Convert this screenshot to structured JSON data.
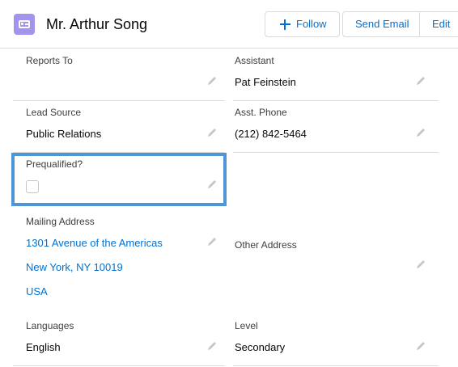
{
  "header": {
    "icon": "contact-card-icon",
    "title": "Mr. Arthur Song",
    "accent": "#a094ed"
  },
  "actions": {
    "follow": "Follow",
    "send_email": "Send Email",
    "edit": "Edit"
  },
  "fields": {
    "reports_to": {
      "label": "Reports To",
      "value": ""
    },
    "assistant": {
      "label": "Assistant",
      "value": "Pat Feinstein"
    },
    "lead_source": {
      "label": "Lead Source",
      "value": "Public Relations"
    },
    "asst_phone": {
      "label": "Asst. Phone",
      "value": "(212) 842-5464"
    },
    "prequalified": {
      "label": "Prequalified?",
      "checked": false
    },
    "mailing_address": {
      "label": "Mailing Address",
      "line1": "1301 Avenue of the Americas",
      "line2": "New York, NY 10019",
      "line3": "USA"
    },
    "other_address": {
      "label": "Other Address",
      "value": ""
    },
    "languages": {
      "label": "Languages",
      "value": "English"
    },
    "level": {
      "label": "Level",
      "value": "Secondary"
    }
  },
  "colors": {
    "link": "#0070d2",
    "focus_border": "#4e96d8",
    "divider": "#dddbda"
  }
}
